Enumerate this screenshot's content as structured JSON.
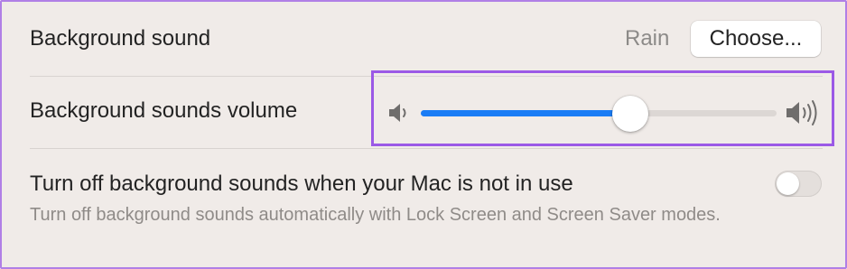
{
  "background_sound": {
    "label": "Background sound",
    "value": "Rain",
    "choose_button": "Choose..."
  },
  "volume": {
    "label": "Background sounds volume",
    "level_fraction": 0.59,
    "low_icon": "speaker-low-icon",
    "high_icon": "speaker-high-icon"
  },
  "turn_off": {
    "label": "Turn off background sounds when your Mac is not in use",
    "description": "Turn off background sounds automatically with Lock Screen and Screen Saver modes.",
    "enabled": false
  },
  "colors": {
    "accent": "#1a7cf5",
    "highlight": "#9b59e6",
    "panel_bg": "#f0ebe8"
  }
}
